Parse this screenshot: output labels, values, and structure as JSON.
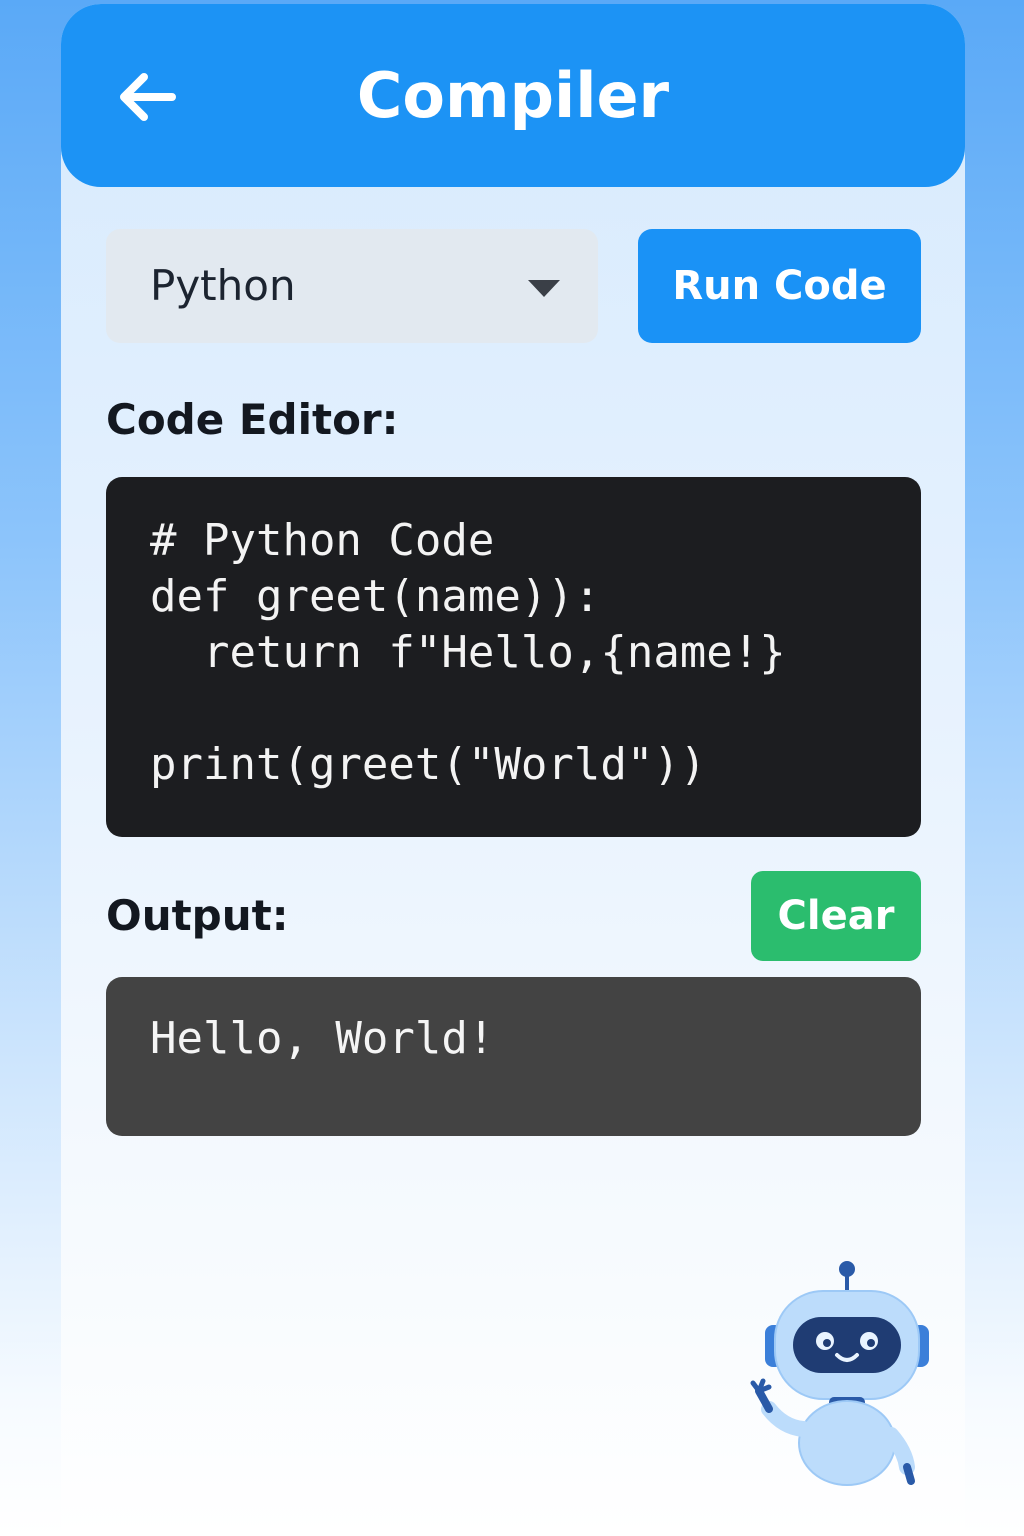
{
  "header": {
    "title": "Compiler",
    "back_icon": "arrow-left-icon"
  },
  "language_select": {
    "value": "Python",
    "icon": "caret-down-icon"
  },
  "toolbar": {
    "run_label": "Run Code",
    "clear_label": "Clear"
  },
  "editor": {
    "label": "Code Editor:",
    "lines": [
      "# Python Code",
      "def greet(name)):",
      "  return f\"Hello,{name!}",
      "",
      "print(greet(\"World\"))"
    ]
  },
  "output": {
    "label": "Output:",
    "text": "Hello, World!"
  },
  "mascot": {
    "icon": "robot-mascot"
  },
  "colors": {
    "accent": "#1c93f5",
    "success": "#2bbd6e",
    "editor_bg": "#1c1d20",
    "output_bg": "#434343"
  }
}
